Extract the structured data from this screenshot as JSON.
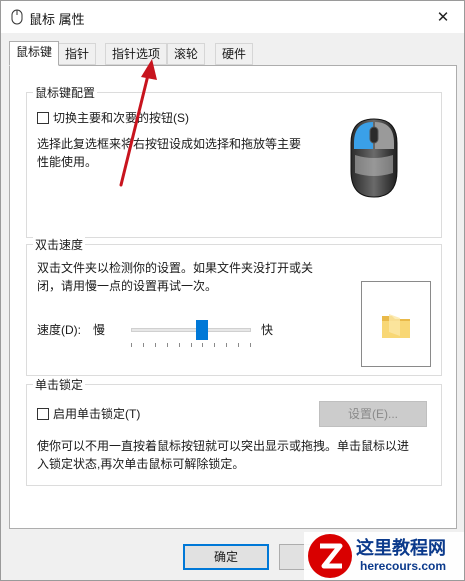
{
  "window": {
    "title": "鼠标 属性",
    "close_glyph": "✕"
  },
  "tabs": [
    {
      "label": "鼠标键",
      "active": true
    },
    {
      "label": "指针",
      "active": false
    },
    {
      "label": "指针选项",
      "active": false
    },
    {
      "label": "滚轮",
      "active": false
    },
    {
      "label": "硬件",
      "active": false
    }
  ],
  "button_config": {
    "group_title": "鼠标键配置",
    "switch_checkbox_label": "切换主要和次要的按钮(S)",
    "switch_checked": false,
    "description_line1": "选择此复选框来将右按钮设成如选择和拖放等主要",
    "description_line2": "性能使用。",
    "mouse_image": "mouse-left-button-highlighted-icon"
  },
  "double_click": {
    "group_title": "双击速度",
    "description_line1": "双击文件夹以检测你的设置。如果文件夹没打开或关",
    "description_line2": "闭，请用慢一点的设置再试一次。",
    "speed_label": "速度(D):",
    "slow_label": "慢",
    "fast_label": "快",
    "speed_value_fraction": 0.6,
    "test_folder_icon": "folder-icon"
  },
  "click_lock": {
    "group_title": "单击锁定",
    "checkbox_label": "启用单击锁定(T)",
    "checked": false,
    "settings_button": "设置(E)...",
    "description_line1": "使你可以不用一直按着鼠标按钮就可以突出显示或拖拽。单击鼠标以进",
    "description_line2": "入锁定状态,再次单击鼠标可解除锁定。"
  },
  "footer": {
    "ok_button": "确定"
  },
  "watermark": {
    "title": "这里教程网",
    "url": "herecours.com"
  },
  "colors": {
    "accent": "#0078d7",
    "annotation_arrow": "#c8141e"
  }
}
